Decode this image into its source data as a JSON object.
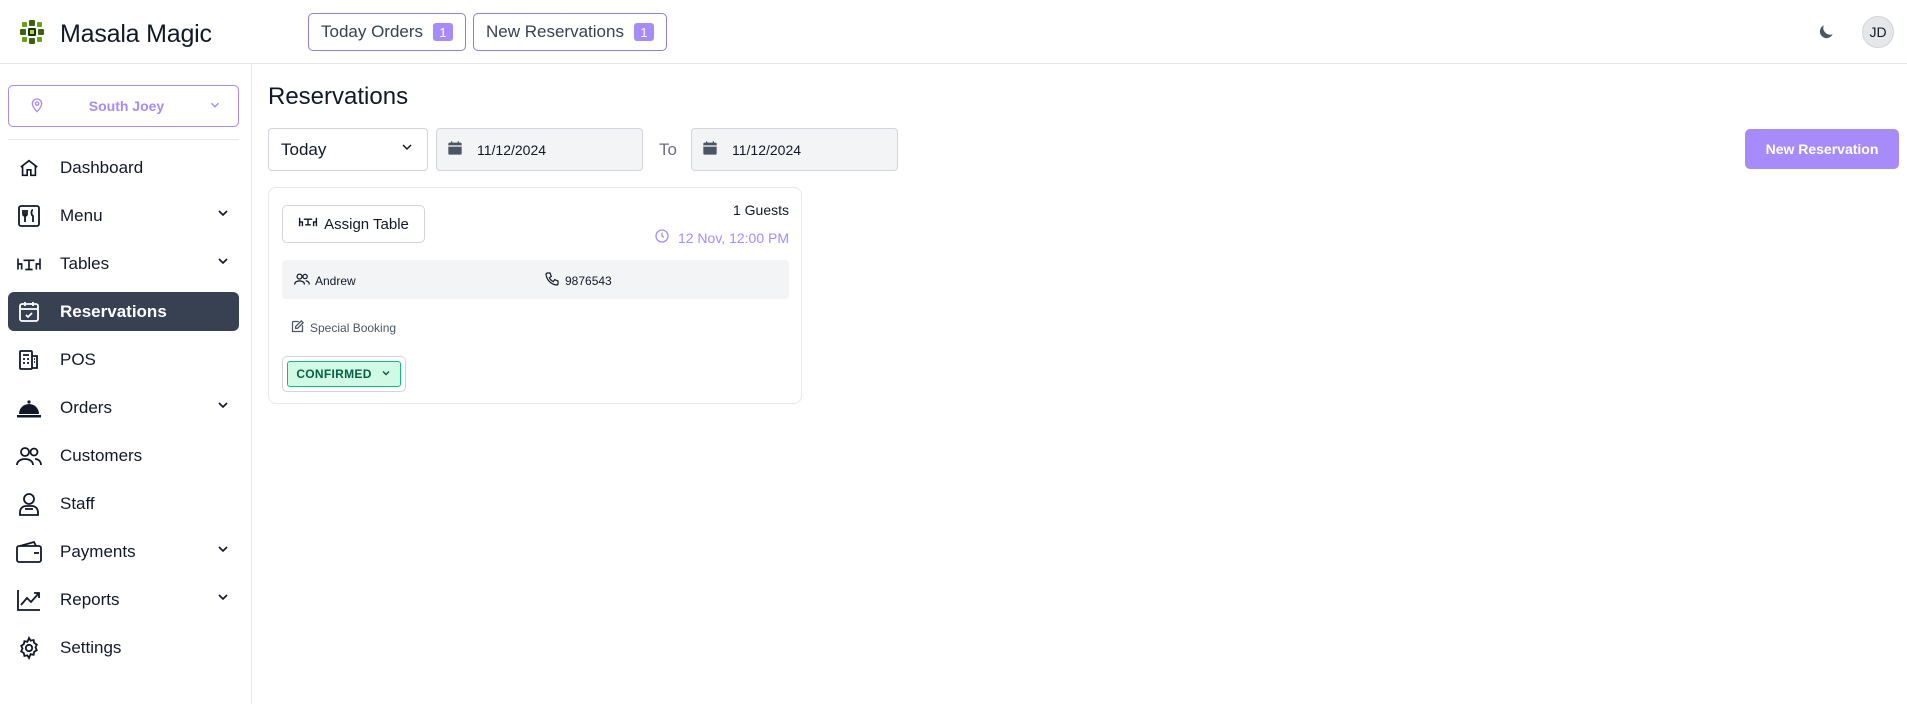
{
  "app": {
    "name": "Masala Magic",
    "logo_icon": "chakra-logo-icon"
  },
  "header": {
    "today_orders_label": "Today Orders",
    "today_orders_count": "1",
    "new_reservations_label": "New Reservations",
    "new_reservations_count": "1",
    "user_initials": "JD"
  },
  "sidebar": {
    "branch": "South Joey",
    "items": [
      {
        "label": "Dashboard",
        "icon": "home-icon"
      },
      {
        "label": "Menu",
        "icon": "menu-utensils-icon"
      },
      {
        "label": "Tables",
        "icon": "table-icon"
      },
      {
        "label": "Reservations",
        "icon": "calendar-check-icon"
      },
      {
        "label": "POS",
        "icon": "pos-icon"
      },
      {
        "label": "Orders",
        "icon": "cloche-icon"
      },
      {
        "label": "Customers",
        "icon": "users-icon"
      },
      {
        "label": "Staff",
        "icon": "staff-icon"
      },
      {
        "label": "Payments",
        "icon": "wallet-icon"
      },
      {
        "label": "Reports",
        "icon": "chart-line-icon"
      },
      {
        "label": "Settings",
        "icon": "gear-icon"
      }
    ]
  },
  "main": {
    "title": "Reservations",
    "range": "Today",
    "date_from": "11/12/2024",
    "to_label": "To",
    "date_to": "11/12/2024",
    "new_button": "New Reservation"
  },
  "reservation": {
    "assign_label": "Assign Table",
    "guests": "1 Guests",
    "time": "12 Nov, 12:00 PM",
    "name": "Andrew",
    "phone": "9876543",
    "note": "Special Booking",
    "status": "CONFIRMED"
  },
  "colors": {
    "accent": "#a78bfa",
    "active_nav": "#374151",
    "confirmed_bg": "#d1fae5",
    "confirmed_border": "#10b981"
  }
}
